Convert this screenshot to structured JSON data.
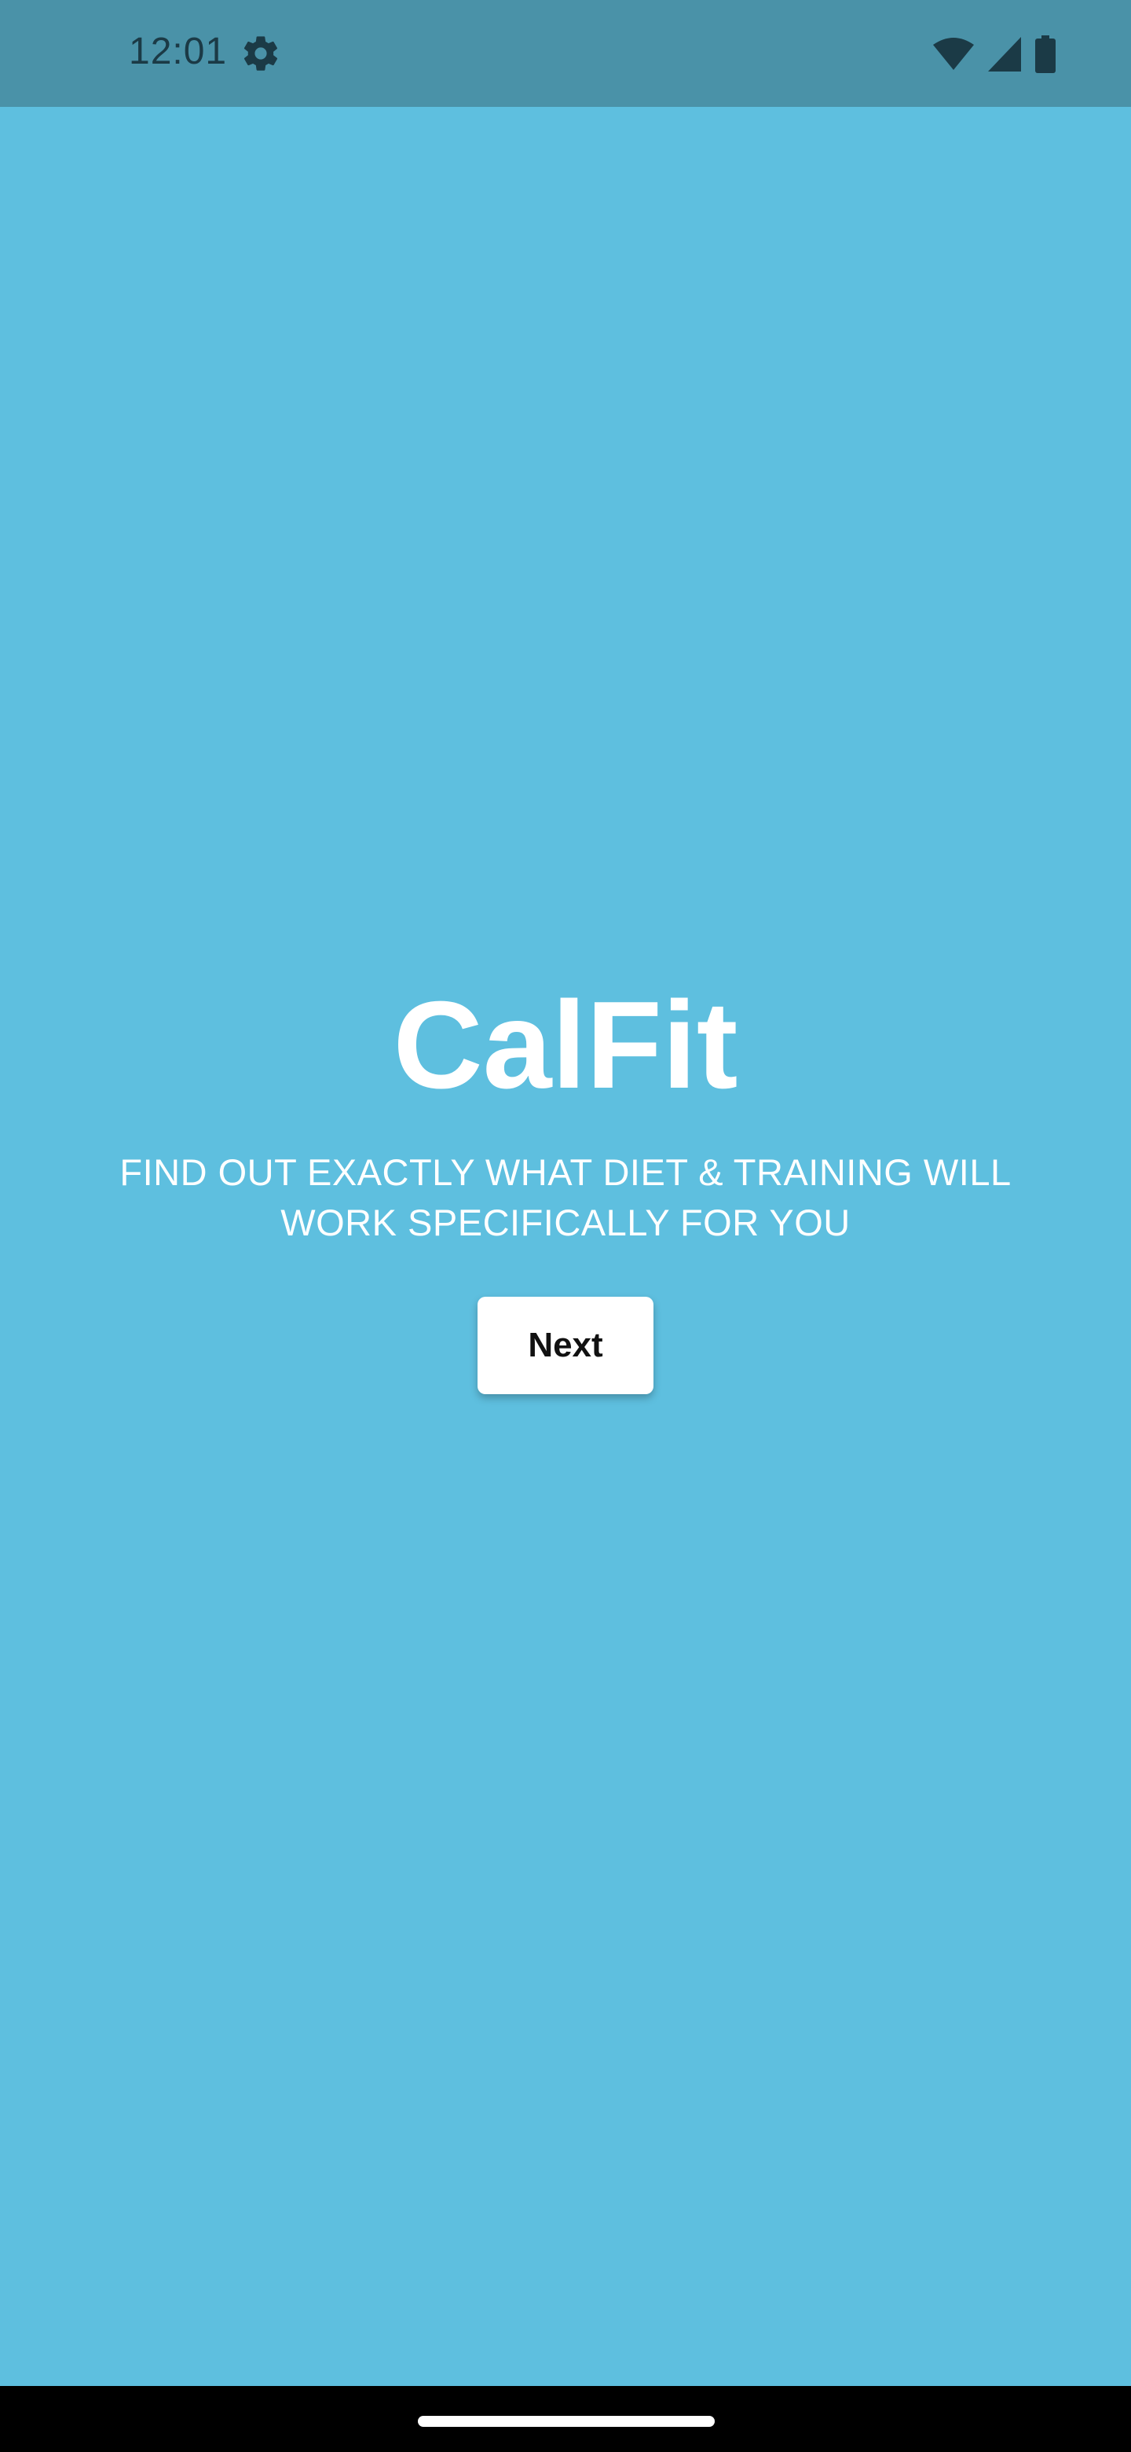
{
  "status_bar": {
    "time": "12:01",
    "icons": [
      "settings-gear-icon",
      "wifi-icon",
      "cellular-signal-icon",
      "battery-icon"
    ]
  },
  "main": {
    "title": "CalFit",
    "tagline_line1": "FIND OUT EXACTLY WHAT DIET & TRAINING WILL",
    "tagline_line2": "WORK SPECIFICALLY FOR YOU",
    "next_button_label": "Next"
  },
  "colors": {
    "background": "#5ebfdf",
    "status_bar": "#4a92a8",
    "button": "#ffffff",
    "nav_bar": "#000000"
  }
}
